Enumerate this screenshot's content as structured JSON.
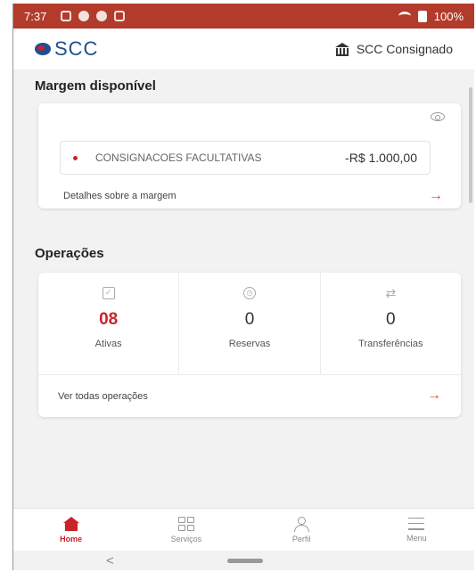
{
  "status_bar": {
    "time": "7:37",
    "battery": "100%"
  },
  "header": {
    "brand": "SCC",
    "org_name": "SCC Consignado"
  },
  "margin_section": {
    "title": "Margem disponível",
    "item": {
      "name": "CONSIGNACOES FACULTATIVAS",
      "value": "-R$ 1.000,00"
    },
    "details_link": "Detalhes sobre a margem",
    "arrow": "→"
  },
  "operations_section": {
    "title": "Operações",
    "items": [
      {
        "icon": "check-square-icon",
        "glyph": "✓",
        "value": "08",
        "label": "Ativas"
      },
      {
        "icon": "clock-icon",
        "glyph": "◷",
        "value": "0",
        "label": "Reservas"
      },
      {
        "icon": "transfer-icon",
        "glyph": "⇄",
        "value": "0",
        "label": "Transferências"
      }
    ],
    "see_all_link": "Ver todas operações",
    "arrow": "→"
  },
  "bottom_nav": [
    {
      "label": "Home",
      "icon": "home-icon",
      "active": true
    },
    {
      "label": "Serviços",
      "icon": "grid-icon",
      "active": false
    },
    {
      "label": "Perfil",
      "icon": "person-icon",
      "active": false
    },
    {
      "label": "Menu",
      "icon": "menu-icon",
      "active": false
    }
  ],
  "system_nav": {
    "back": "<"
  },
  "colors": {
    "status_bar": "#b33b2b",
    "accent": "#c8242b",
    "arrow": "#e2442f",
    "brand_blue": "#1e4f8f"
  }
}
